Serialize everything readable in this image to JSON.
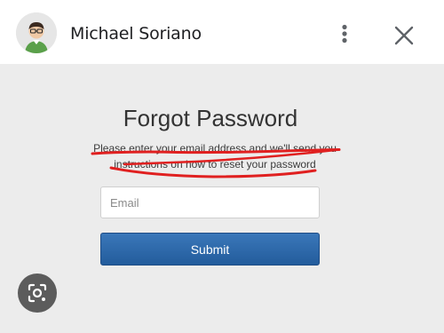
{
  "header": {
    "contact_name": "Michael Soriano",
    "icons": {
      "avatar": "avatar-image",
      "more": "more-vert-icon",
      "close": "close-icon"
    }
  },
  "form": {
    "title": "Forgot Password",
    "instructions_line1": "Please enter your email address and we'll send you",
    "instructions_line2": "instructions on how to reset your password",
    "email_placeholder": "Email",
    "email_value": "",
    "submit_label": "Submit"
  },
  "annotation": {
    "underline_color": "#e02020"
  },
  "overlay": {
    "lens_icon": "lens-search-icon"
  },
  "colors": {
    "button": "#2b66a8",
    "background": "#ececec"
  }
}
